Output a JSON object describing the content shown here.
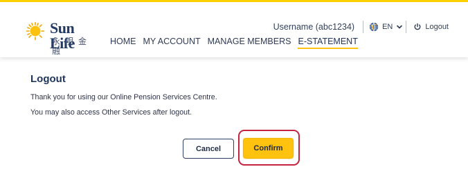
{
  "brand": {
    "name": "Sun Life",
    "chinese_name": "永明金融",
    "accent_color": "#ffd100",
    "brand_color": "#223a63"
  },
  "header": {
    "username_label": "Username (abc1234)",
    "language_code": "EN",
    "logout_label": "Logout",
    "icons": {
      "language": "globe-icon",
      "dropdown": "chevron-down-icon",
      "logout": "power-icon"
    }
  },
  "nav": {
    "items": [
      {
        "label": "HOME"
      },
      {
        "label": "MY ACCOUNT"
      },
      {
        "label": "MANAGE MEMBERS"
      },
      {
        "label": "E-STATEMENT"
      }
    ],
    "active_index": 3
  },
  "page": {
    "title": "Logout",
    "lines": [
      "Thank you for using our Online Pension Services Centre.",
      "You may also access Other Services after logout."
    ]
  },
  "actions": {
    "cancel_label": "Cancel",
    "confirm_label": "Confirm",
    "confirm_color": "#ffc20e",
    "highlight_color": "#c4223f"
  }
}
